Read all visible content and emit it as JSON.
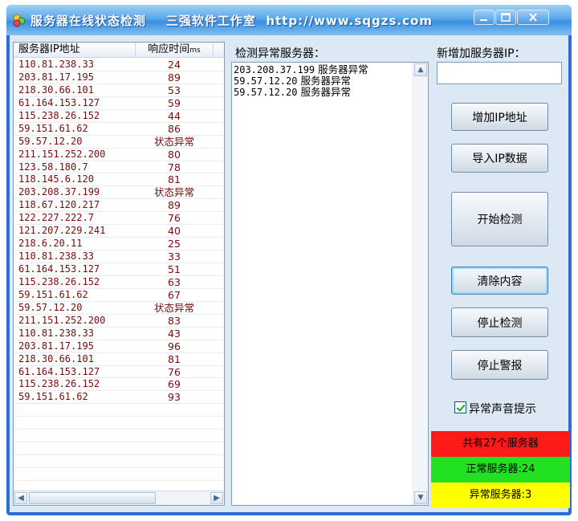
{
  "window": {
    "title": "服务器在线状态检测    三强软件工作室  http://www.sqgzs.com"
  },
  "list": {
    "col_ip": "服务器IP地址",
    "col_time": "响应时间",
    "col_time_unit": "ms",
    "rows": [
      {
        "ip": "110.81.238.33",
        "ms": "24"
      },
      {
        "ip": "203.81.17.195",
        "ms": "89"
      },
      {
        "ip": "218.30.66.101",
        "ms": "53"
      },
      {
        "ip": "61.164.153.127",
        "ms": "59"
      },
      {
        "ip": "115.238.26.152",
        "ms": "44"
      },
      {
        "ip": "59.151.61.62",
        "ms": "86"
      },
      {
        "ip": "59.57.12.20",
        "ms": "状态异常"
      },
      {
        "ip": "211.151.252.200",
        "ms": "80"
      },
      {
        "ip": "123.58.180.7",
        "ms": "78"
      },
      {
        "ip": "118.145.6.120",
        "ms": "81"
      },
      {
        "ip": "203.208.37.199",
        "ms": "状态异常"
      },
      {
        "ip": "118.67.120.217",
        "ms": "89"
      },
      {
        "ip": "122.227.222.7",
        "ms": "76"
      },
      {
        "ip": "121.207.229.241",
        "ms": "40"
      },
      {
        "ip": "218.6.20.11",
        "ms": "25"
      },
      {
        "ip": "110.81.238.33",
        "ms": "33"
      },
      {
        "ip": "61.164.153.127",
        "ms": "51"
      },
      {
        "ip": "115.238.26.152",
        "ms": "63"
      },
      {
        "ip": "59.151.61.62",
        "ms": "67"
      },
      {
        "ip": "59.57.12.20",
        "ms": "状态异常"
      },
      {
        "ip": "211.151.252.200",
        "ms": "83"
      },
      {
        "ip": "110.81.238.33",
        "ms": "43"
      },
      {
        "ip": "203.81.17.195",
        "ms": "96"
      },
      {
        "ip": "218.30.66.101",
        "ms": "81"
      },
      {
        "ip": "61.164.153.127",
        "ms": "76"
      },
      {
        "ip": "115.238.26.152",
        "ms": "69"
      },
      {
        "ip": "59.151.61.62",
        "ms": "93"
      }
    ]
  },
  "abnormal": {
    "label": "检测异常服务器：",
    "lines": [
      {
        "ip": "203.208.37.199",
        "text": "服务器异常"
      },
      {
        "ip": "59.57.12.20",
        "text": "服务器异常"
      },
      {
        "ip": "59.57.12.20",
        "text": "服务器异常"
      }
    ]
  },
  "controls": {
    "new_ip_label": "新增加服务器IP：",
    "new_ip_value": "",
    "add_ip": "增加IP地址",
    "import_ip": "导入IP数据",
    "start": "开始检测",
    "clear": "清除内容",
    "stop": "停止检测",
    "stop_alarm": "停止警报",
    "sound_label": "异常声音提示",
    "sound_checked": true
  },
  "status": {
    "total": "共有27个服务器",
    "normal": "正常服务器:24",
    "abnormal": "异常服务器:3",
    "colors": {
      "total": "#ff1a1a",
      "normal": "#22e022",
      "abnormal": "#ffff00"
    }
  }
}
